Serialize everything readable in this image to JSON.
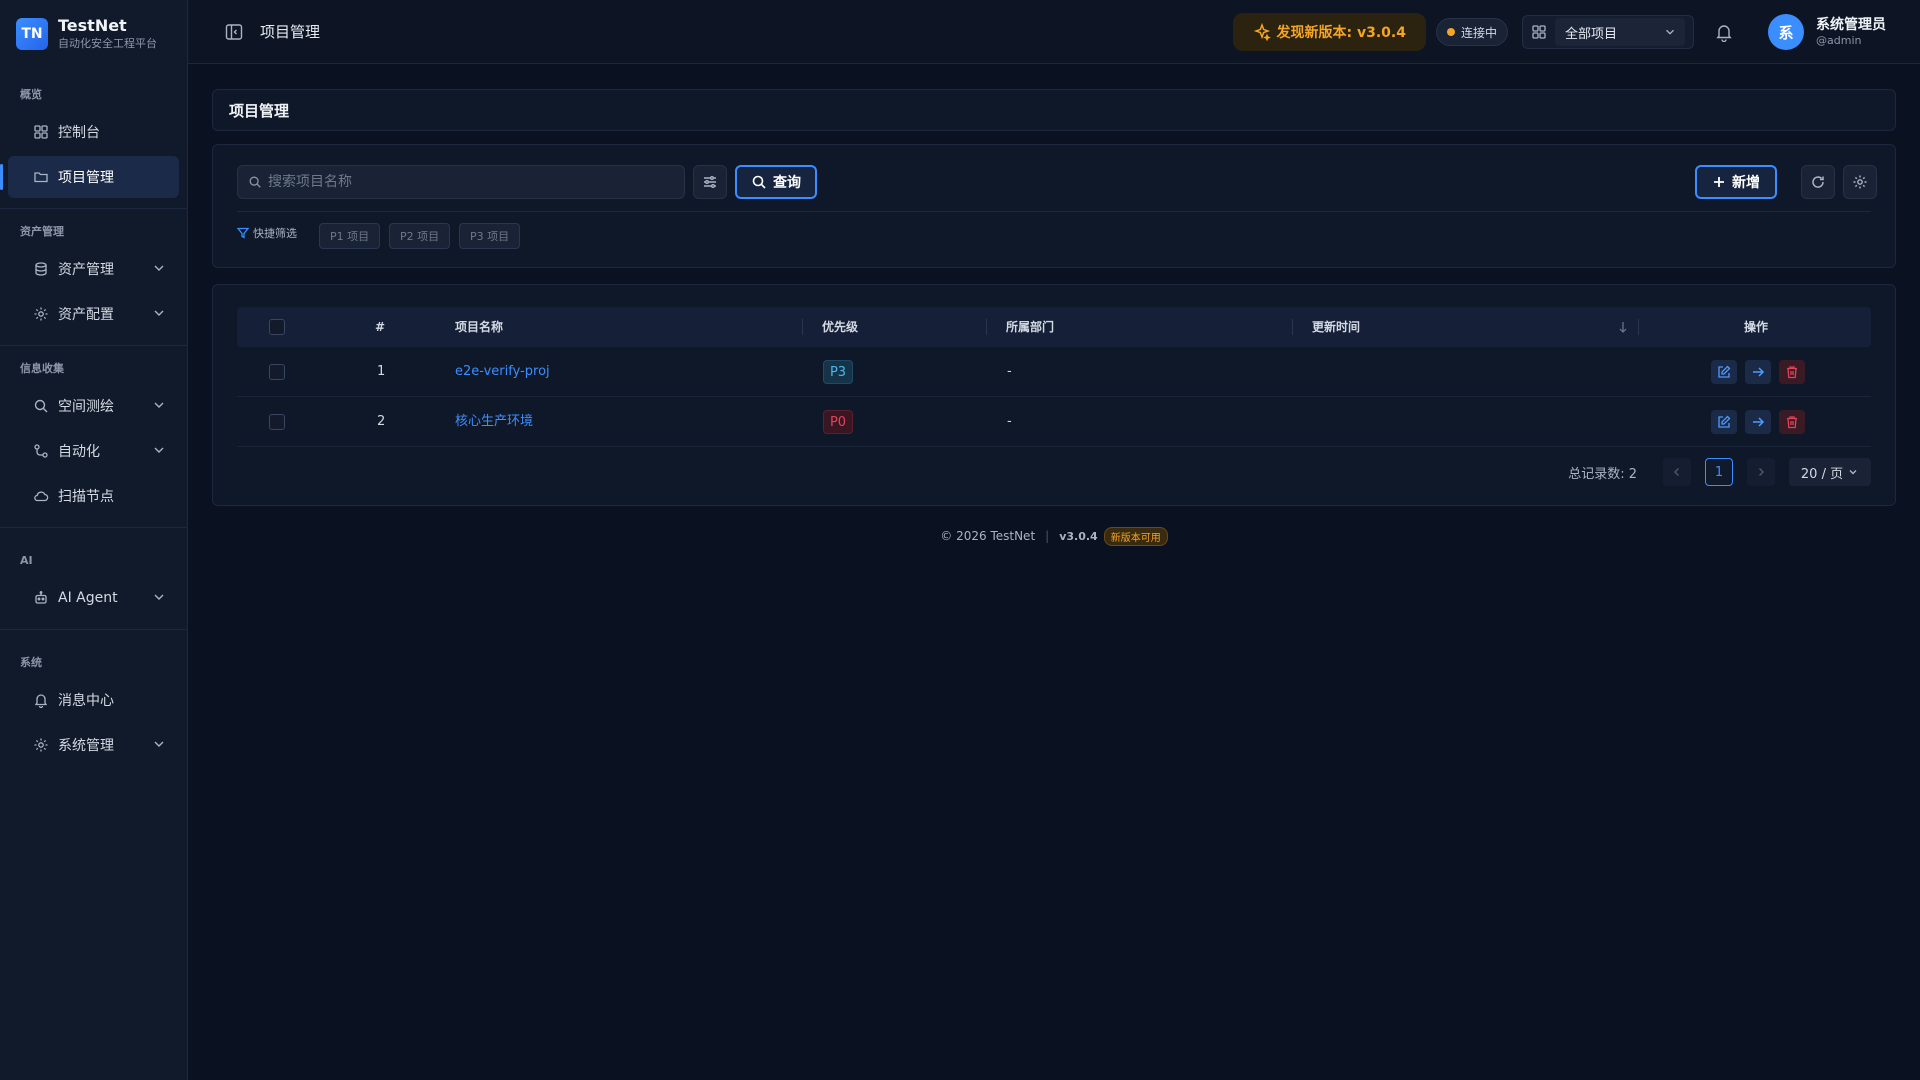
{
  "brand": {
    "logo": "TN",
    "name": "TestNet",
    "subtitle": "自动化安全工程平台"
  },
  "sidebar": {
    "sections": [
      {
        "label": "概览",
        "items": [
          {
            "label": "控制台",
            "icon": "dashboard-icon",
            "active": false,
            "expandable": false
          },
          {
            "label": "项目管理",
            "icon": "folder-icon",
            "active": true,
            "expandable": false
          }
        ]
      },
      {
        "label": "资产管理",
        "items": [
          {
            "label": "资产管理",
            "icon": "database-icon",
            "expandable": true
          },
          {
            "label": "资产配置",
            "icon": "gear-icon",
            "expandable": true
          }
        ]
      },
      {
        "label": "信息收集",
        "items": [
          {
            "label": "空间测绘",
            "icon": "search-icon",
            "expandable": true
          },
          {
            "label": "自动化",
            "icon": "workflow-icon",
            "expandable": true
          },
          {
            "label": "扫描节点",
            "icon": "cloud-icon",
            "expandable": false
          }
        ]
      },
      {
        "label": "AI",
        "items": [
          {
            "label": "AI Agent",
            "icon": "robot-icon",
            "expandable": true
          }
        ]
      },
      {
        "label": "系统",
        "items": [
          {
            "label": "消息中心",
            "icon": "bell-icon",
            "expandable": false
          },
          {
            "label": "系统管理",
            "icon": "gear-icon",
            "expandable": true
          }
        ]
      }
    ]
  },
  "header": {
    "breadcrumb": "项目管理",
    "upgrade_label": "发现新版本: v3.0.4",
    "connection_status": "连接中",
    "project_select": "全部项目",
    "user": {
      "avatar": "系",
      "name": "系统管理员",
      "handle": "@admin"
    }
  },
  "page": {
    "title": "项目管理",
    "search_placeholder": "搜索项目名称",
    "query_label": "查询",
    "new_label": "新增",
    "quick_filter_label": "快捷筛选",
    "quick_tags": [
      "P1 项目",
      "P2 项目",
      "P3 项目"
    ]
  },
  "table": {
    "headers": {
      "index": "#",
      "name": "项目名称",
      "priority": "优先级",
      "department": "所属部门",
      "updated": "更新时间",
      "actions": "操作"
    },
    "rows": [
      {
        "index": "1",
        "name": "e2e-verify-proj",
        "priority": "P3",
        "department": "-",
        "updated": ""
      },
      {
        "index": "2",
        "name": "核心生产环境",
        "priority": "P0",
        "department": "-",
        "updated": ""
      }
    ]
  },
  "pagination": {
    "total_label": "总记录数: 2",
    "current_page": "1",
    "page_size": "20 / 页"
  },
  "footer": {
    "copyright": "© 2026 TestNet",
    "version": "v3.0.4",
    "badge": "新版本可用"
  },
  "colors": {
    "accent": "#3b8eff",
    "warning": "#f5a524",
    "danger": "#e0445a",
    "background": "#0a1120"
  }
}
